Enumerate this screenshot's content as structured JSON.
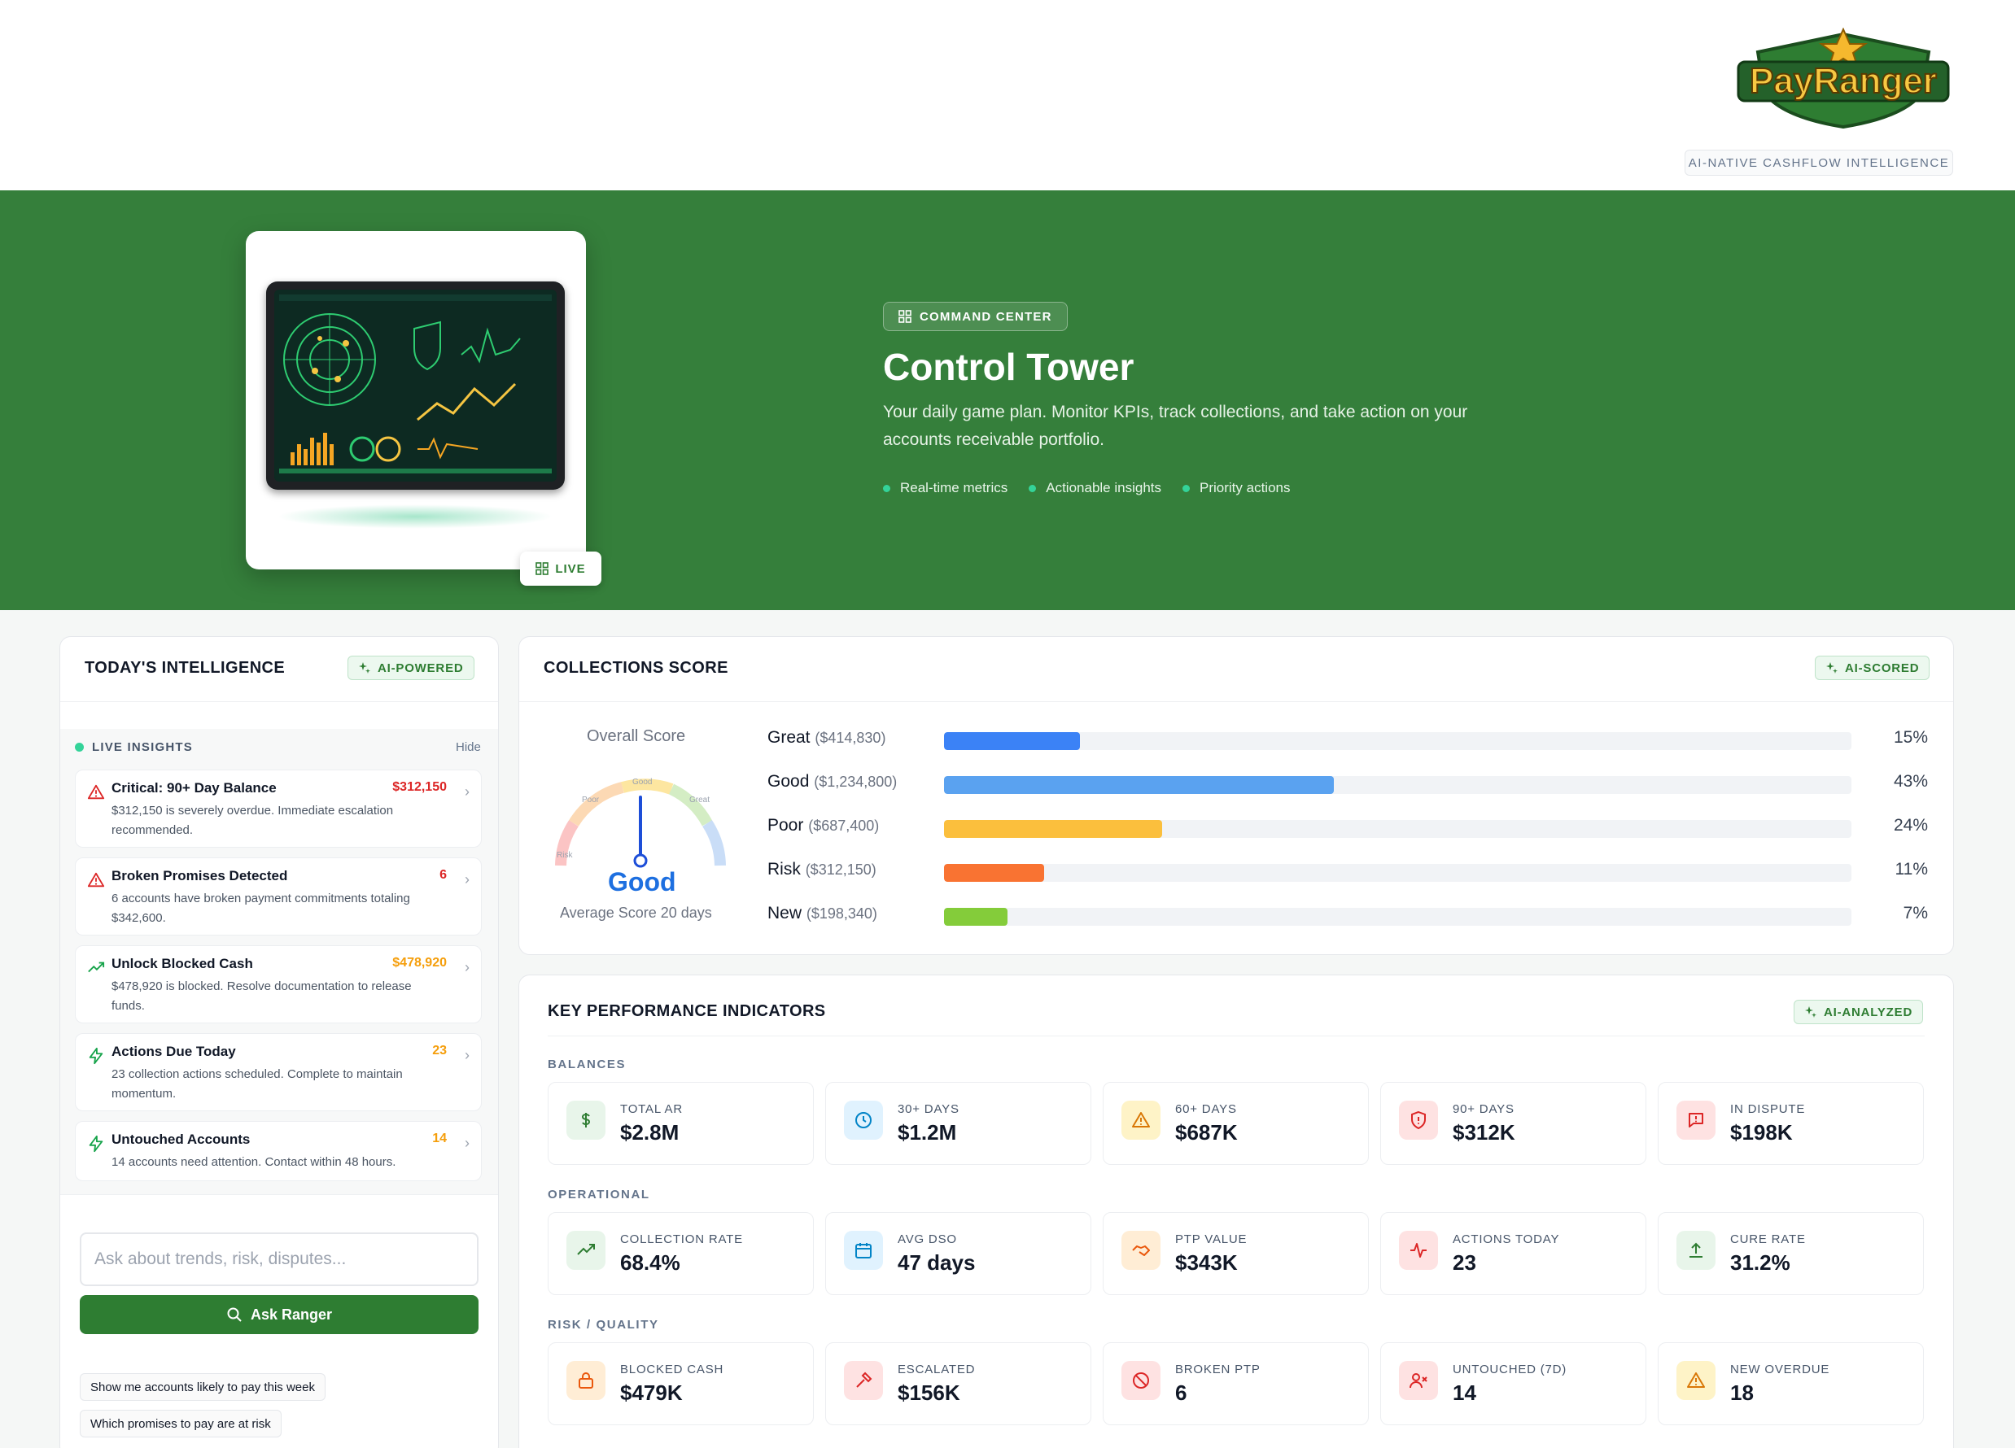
{
  "brand": {
    "logo_text": "PayRanger",
    "tagline": "AI-NATIVE CASHFLOW INTELLIGENCE"
  },
  "hero": {
    "live_label": "LIVE",
    "badge": "COMMAND CENTER",
    "title": "Control Tower",
    "subtitle": "Your daily game plan. Monitor KPIs, track collections, and take action on your accounts receivable portfolio.",
    "bullets": [
      "Real-time metrics",
      "Actionable insights",
      "Priority actions"
    ]
  },
  "intelligence": {
    "title": "TODAY'S INTELLIGENCE",
    "badge": "AI-POWERED",
    "live_label": "LIVE INSIGHTS",
    "hide_label": "Hide",
    "insights": [
      {
        "icon": "alert-triangle-icon",
        "title": "Critical: 90+ Day Balance",
        "value": "$312,150",
        "value_color": "#dc2626",
        "desc": "$312,150 is severely overdue. Immediate escalation recommended."
      },
      {
        "icon": "alert-triangle-icon",
        "title": "Broken Promises Detected",
        "value": "6",
        "value_color": "#dc2626",
        "desc": "6 accounts have broken payment commitments totaling $342,600."
      },
      {
        "icon": "trending-up-icon",
        "title": "Unlock Blocked Cash",
        "value": "$478,920",
        "value_color": "#f59e0b",
        "desc": "$478,920 is blocked. Resolve documentation to release funds."
      },
      {
        "icon": "lightning-icon",
        "title": "Actions Due Today",
        "value": "23",
        "value_color": "#f59e0b",
        "desc": "23 collection actions scheduled. Complete to maintain momentum."
      },
      {
        "icon": "lightning-icon",
        "title": "Untouched Accounts",
        "value": "14",
        "value_color": "#f59e0b",
        "desc": "14 accounts need attention. Contact within 48 hours."
      }
    ],
    "ask_placeholder": "Ask about trends, risk, disputes...",
    "ask_button": "Ask Ranger",
    "suggestions": [
      "Show me accounts likely to pay this week",
      "Which promises to pay are at risk"
    ]
  },
  "collections": {
    "title": "COLLECTIONS SCORE",
    "badge": "AI-SCORED",
    "overall_label": "Overall Score",
    "gauge_labels": [
      "Risk",
      "Poor",
      "Good",
      "Great"
    ],
    "score_label": "Good",
    "score_sub": "Average Score 20 days",
    "gauge_level": 0.5,
    "rows": [
      {
        "label": "Great",
        "amount": "($414,830)",
        "pct": "15%",
        "value": 15,
        "color": "#3b82f6"
      },
      {
        "label": "Good",
        "amount": "($1,234,800)",
        "pct": "43%",
        "value": 43,
        "color": "#5aa2f0"
      },
      {
        "label": "Poor",
        "amount": "($687,400)",
        "pct": "24%",
        "value": 24,
        "color": "#fbbf3d"
      },
      {
        "label": "Risk",
        "amount": "($312,150)",
        "pct": "11%",
        "value": 11,
        "color": "#f97332"
      },
      {
        "label": "New",
        "amount": "($198,340)",
        "pct": "7%",
        "value": 7,
        "color": "#84cc3a"
      }
    ]
  },
  "kpis": {
    "title": "KEY PERFORMANCE INDICATORS",
    "badge": "AI-ANALYZED",
    "sections": [
      {
        "name": "BALANCES",
        "items": [
          {
            "label": "TOTAL AR",
            "value": "$2.8M",
            "icon": "dollar-icon",
            "bg": "#e8f5ea",
            "fg": "#2e7d32"
          },
          {
            "label": "30+ DAYS",
            "value": "$1.2M",
            "icon": "clock-icon",
            "bg": "#e0f2fe",
            "fg": "#0284c7"
          },
          {
            "label": "60+ DAYS",
            "value": "$687K",
            "icon": "warning-icon",
            "bg": "#fef3c7",
            "fg": "#d97706"
          },
          {
            "label": "90+ DAYS",
            "value": "$312K",
            "icon": "shield-alert-icon",
            "bg": "#fee2e2",
            "fg": "#dc2626"
          },
          {
            "label": "IN DISPUTE",
            "value": "$198K",
            "icon": "message-alert-icon",
            "bg": "#fee2e2",
            "fg": "#dc2626"
          }
        ]
      },
      {
        "name": "OPERATIONAL",
        "items": [
          {
            "label": "COLLECTION RATE",
            "value": "68.4%",
            "icon": "trending-up-icon",
            "bg": "#e8f5ea",
            "fg": "#2e7d32"
          },
          {
            "label": "AVG DSO",
            "value": "47 days",
            "icon": "calendar-icon",
            "bg": "#e0f2fe",
            "fg": "#0284c7"
          },
          {
            "label": "PTP VALUE",
            "value": "$343K",
            "icon": "handshake-icon",
            "bg": "#ffedd5",
            "fg": "#ea580c"
          },
          {
            "label": "ACTIONS TODAY",
            "value": "23",
            "icon": "activity-icon",
            "bg": "#fee2e2",
            "fg": "#dc2626"
          },
          {
            "label": "CURE RATE",
            "value": "31.2%",
            "icon": "upload-icon",
            "bg": "#e8f5ea",
            "fg": "#2e7d32"
          }
        ]
      },
      {
        "name": "RISK / QUALITY",
        "items": [
          {
            "label": "BLOCKED CASH",
            "value": "$479K",
            "icon": "lock-icon",
            "bg": "#ffedd5",
            "fg": "#ea580c"
          },
          {
            "label": "ESCALATED",
            "value": "$156K",
            "icon": "gavel-icon",
            "bg": "#fee2e2",
            "fg": "#dc2626"
          },
          {
            "label": "BROKEN PTP",
            "value": "6",
            "icon": "ban-icon",
            "bg": "#fee2e2",
            "fg": "#dc2626"
          },
          {
            "label": "UNTOUCHED (7D)",
            "value": "14",
            "icon": "user-x-icon",
            "bg": "#fee2e2",
            "fg": "#dc2626"
          },
          {
            "label": "NEW OVERDUE",
            "value": "18",
            "icon": "warning-icon",
            "bg": "#fef3c7",
            "fg": "#d97706"
          }
        ]
      }
    ]
  }
}
